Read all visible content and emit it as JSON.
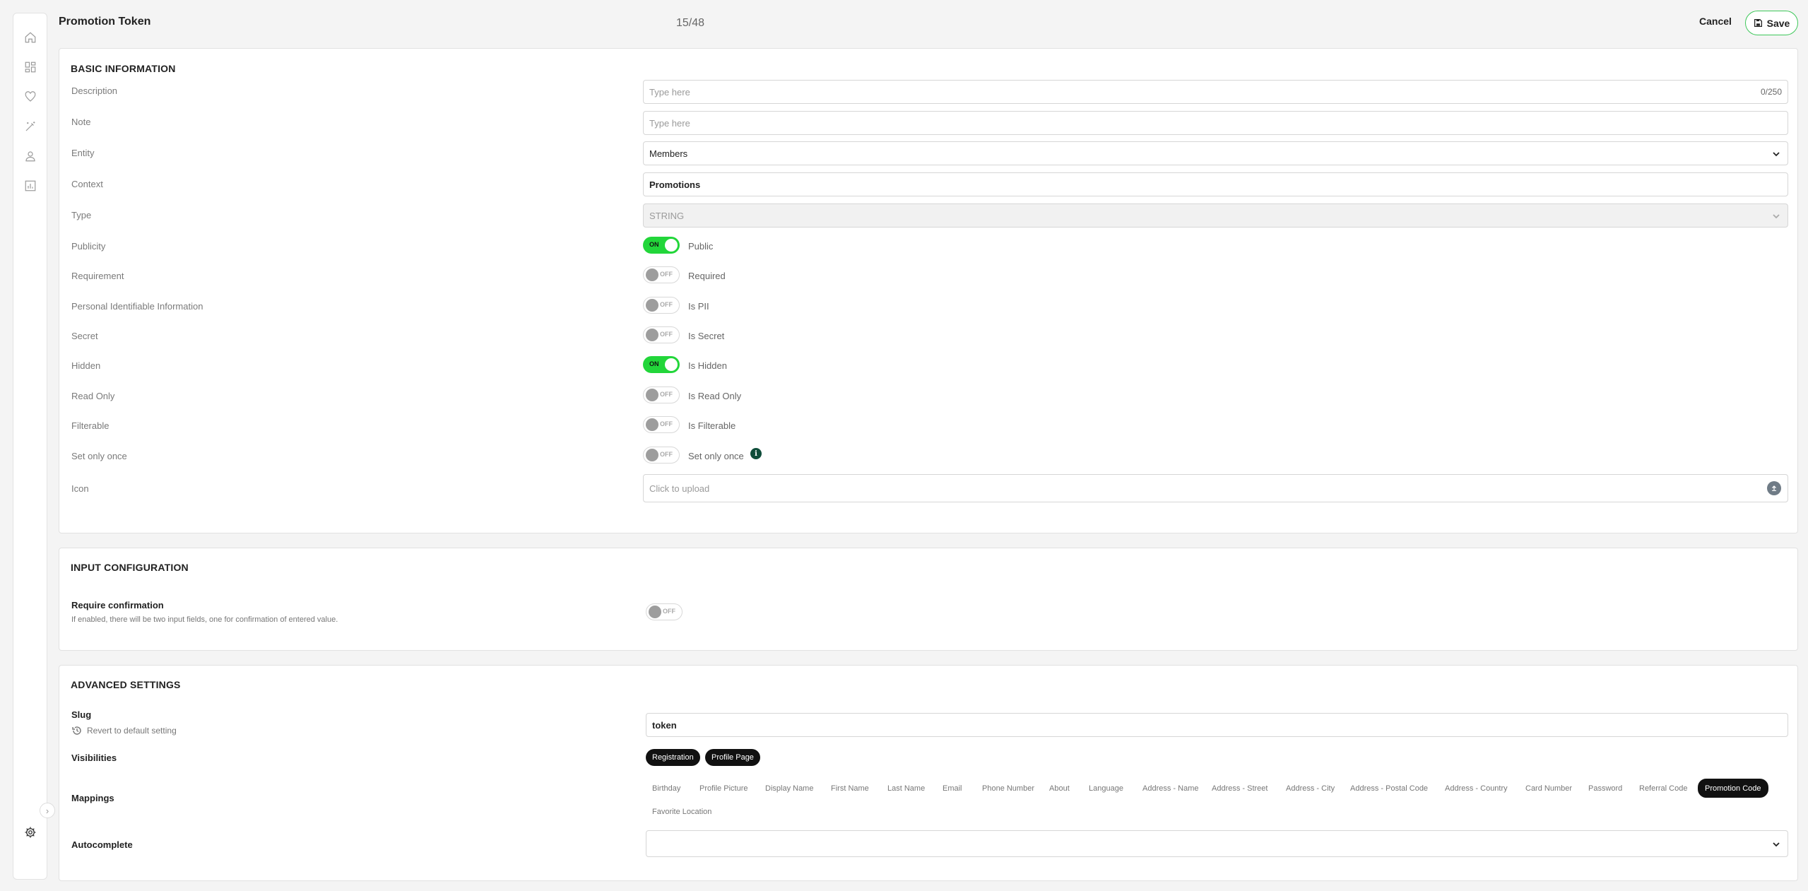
{
  "header": {
    "title": "Promotion Token",
    "counter": "15/48",
    "cancel_label": "Cancel",
    "save_label": "Save"
  },
  "sidebar": {
    "icons": [
      "home-icon",
      "dashboard-icon",
      "heart-icon",
      "magic-wand-icon",
      "user-icon",
      "report-icon"
    ],
    "expand_glyph": "›",
    "settings_icon": "gear-icon"
  },
  "basic": {
    "title": "BASIC INFORMATION",
    "description": {
      "label": "Description",
      "placeholder": "Type here",
      "count": "0/250"
    },
    "note": {
      "label": "Note",
      "placeholder": "Type here"
    },
    "entity": {
      "label": "Entity",
      "value": "Members"
    },
    "context": {
      "label": "Context",
      "value": "Promotions"
    },
    "type": {
      "label": "Type",
      "value": "STRING"
    },
    "toggles": [
      {
        "label": "Publicity",
        "state": "ON",
        "text": "Public"
      },
      {
        "label": "Requirement",
        "state": "OFF",
        "text": "Required"
      },
      {
        "label": "Personal Identifiable Information",
        "state": "OFF",
        "text": "Is PII"
      },
      {
        "label": "Secret",
        "state": "OFF",
        "text": "Is Secret"
      },
      {
        "label": "Hidden",
        "state": "ON",
        "text": "Is Hidden"
      },
      {
        "label": "Read Only",
        "state": "OFF",
        "text": "Is Read Only"
      },
      {
        "label": "Filterable",
        "state": "OFF",
        "text": "Is Filterable"
      },
      {
        "label": "Set only once",
        "state": "OFF",
        "text": "Set only once"
      }
    ],
    "info_glyph": "i",
    "icon": {
      "label": "Icon",
      "placeholder": "Click to upload"
    }
  },
  "input_config": {
    "title": "INPUT CONFIGURATION",
    "require_label": "Require confirmation",
    "require_hint": "If enabled, there will be two input fields, one for confirmation of entered value.",
    "require_state": "OFF"
  },
  "advanced": {
    "title": "ADVANCED SETTINGS",
    "slug_label": "Slug",
    "revert_label": "Revert to default setting",
    "slug_value": "token",
    "visibilities_label": "Visibilities",
    "visibilities": [
      "Registration",
      "Profile Page"
    ],
    "mappings_label": "Mappings",
    "mappings": [
      "Birthday",
      "Profile Picture",
      "Display Name",
      "First Name",
      "Last Name",
      "Email",
      "Phone Number",
      "About",
      "Language",
      "Address - Name",
      "Address - Street",
      "Address - City",
      "Address - Postal Code",
      "Address - Country",
      "Card Number",
      "Password",
      "Referral Code",
      "Promotion Code",
      "Favorite Location"
    ],
    "mapping_selected": "Promotion Code",
    "autocomplete_label": "Autocomplete",
    "autocomplete_value": ""
  },
  "colors": {
    "toggle_on": "#22d63a",
    "save_border": "#3ec75a",
    "chip_active": "#111111",
    "info_icon": "#0f4d3a"
  }
}
